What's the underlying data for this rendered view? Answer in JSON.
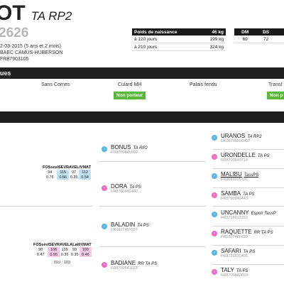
{
  "header": {
    "name": "OT",
    "breed_code": "TA RP2",
    "id_number": "2626",
    "birth_line": "2-03-2015 (5 ans et 2 mois)",
    "breeder": "BAEC CAMUS-HUBERSON",
    "national_id": "FR87903105"
  },
  "weights": {
    "col1": "Poids de naissance",
    "col2": "46 kg",
    "rows": [
      {
        "label": "à 120 jours",
        "value": "199 kg"
      },
      {
        "label": "à 210 jours",
        "value": "324 kg"
      }
    ]
  },
  "dmds": {
    "headers": [
      "DM",
      "DS",
      ""
    ],
    "values": [
      "69",
      "72",
      ""
    ]
  },
  "section1": {
    "title": "ues",
    "cols": [
      "Sans Cornes",
      "Culard MH",
      "Palais fendu",
      "Transl"
    ],
    "button": "Non porteur",
    "button2": "Non p"
  },
  "index_table_1": {
    "headers": [
      "FOSsev",
      "ISEVR",
      "AVEL",
      "IVMAT"
    ],
    "row1": [
      "94",
      "115",
      "97",
      "112"
    ],
    "row2": [
      "0.76",
      "0.56",
      "0.35",
      "0.54"
    ]
  },
  "index_table_2": {
    "headers": [
      "FOSsev",
      "ISEVR",
      "AVEL",
      "ALait",
      "IVMAT"
    ],
    "row1": [
      "90",
      "106",
      "109",
      "93",
      "100"
    ],
    "row2": [
      "0.47",
      "0.55",
      "0.35",
      "0.35",
      "0.46"
    ],
    "isu": "ISU : 103"
  },
  "parents": [
    {
      "name": "BONUS",
      "code": "TA RP2",
      "id": "FR8700849992",
      "sex": "m",
      "icon": "male-icon"
    },
    {
      "name": "DORA",
      "code": "TA PS",
      "id": "FR8700841400",
      "sex": "f",
      "icon": "female-icon"
    },
    {
      "name": "BALADIN",
      "code": "TA PS",
      "id": "FR1827497057",
      "sex": "m",
      "icon": "male-icon"
    },
    {
      "name": "BADIANE",
      "code": "RR TA PS",
      "id": "FR8700841023",
      "sex": "f",
      "icon": "female-icon"
    }
  ],
  "grandparents": [
    {
      "name": "URANOS",
      "code": "TA RP2",
      "id": "DK05706500457",
      "sex": "m"
    },
    {
      "name": "URONDELLE",
      "code": "TA PS",
      "id": "FR8700840714",
      "sex": "f"
    },
    {
      "name": "MALIBU",
      "code": "TassPS",
      "id": "FR3686025196",
      "sex": "m"
    },
    {
      "name": "SAMBA",
      "code": "TA PS",
      "id": "FR8700840443",
      "sex": "f"
    },
    {
      "name": "UNCANNY",
      "code": "Espoir TassP",
      "id": "FR3718013393",
      "sex": "m"
    },
    {
      "name": "RAQUETTE",
      "code": "RR TA PS",
      "id": "FR1827486699",
      "sex": "f"
    },
    {
      "name": "SAFARI",
      "code": "TA PS",
      "id": "FR8729630405",
      "sex": "m"
    },
    {
      "name": "TALY",
      "code": "TA PS",
      "id": "FR8700840650",
      "sex": "f"
    }
  ],
  "colors": {
    "dark": "#1f1f1f",
    "green": "#5cb83a",
    "male": "#57b6df",
    "female": "#ef6bc0"
  }
}
